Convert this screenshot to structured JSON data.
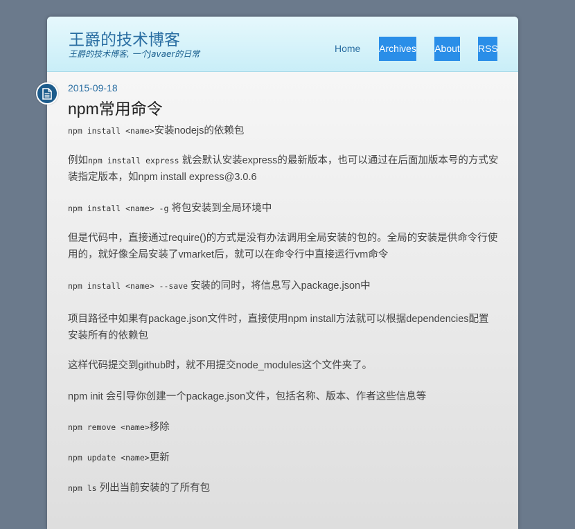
{
  "site": {
    "title": "王爵的技术博客",
    "subtitle": "王爵的技术博客, 一个Javaer的日常"
  },
  "nav": {
    "home": "Home",
    "archives": "Archives",
    "about": "About",
    "rss": "RSS"
  },
  "post": {
    "icon": "document-icon",
    "date": "2015-09-18",
    "title": "npm常用命令",
    "p1_code": "npm install <name>",
    "p1_text": "安装nodejs的依赖包",
    "p2_a": "例如",
    "p2_code": "npm install express",
    "p2_b": " 就会默认安装express的最新版本，也可以通过在后面加版本号的方式安装指定版本，如npm install express@3.0.6",
    "p3_code": "npm install <name> -g",
    "p3_text": " 将包安装到全局环境中",
    "p4": "但是代码中，直接通过require()的方式是没有办法调用全局安装的包的。全局的安装是供命令行使用的，就好像全局安装了vmarket后，就可以在命令行中直接运行vm命令",
    "p5_code": "npm install <name> --save",
    "p5_text": " 安装的同时，将信息写入package.json中",
    "p6": "项目路径中如果有package.json文件时，直接使用npm install方法就可以根据dependencies配置安装所有的依赖包",
    "p7": "这样代码提交到github时，就不用提交node_modules这个文件夹了。",
    "p8": "npm init  会引导你创建一个package.json文件，包括名称、版本、作者这些信息等",
    "p9_code": "npm remove <name>",
    "p9_text": "移除",
    "p10_code": "npm update <name>",
    "p10_text": "更新",
    "p11_code": "npm ls",
    "p11_text": " 列出当前安装的了所有包"
  }
}
